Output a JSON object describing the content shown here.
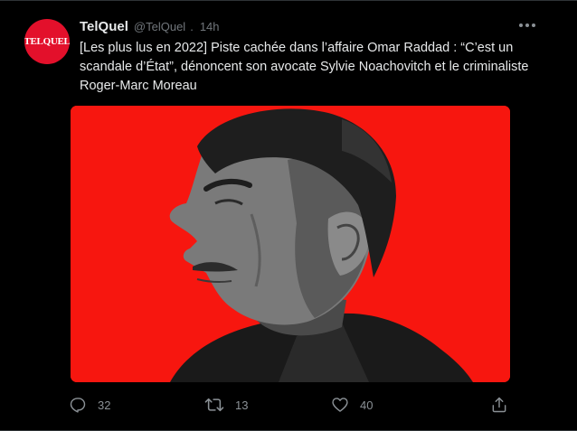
{
  "tweet": {
    "avatar_text": "TELQUEL",
    "display_name": "TelQuel",
    "handle": "@TelQuel",
    "separator": ".",
    "time": "14h",
    "text": "[Les plus lus en 2022] Piste cachée dans l’affaire Omar Raddad : “C’est un scandale d’État”, dénoncent son avocate Sylvie Noachovitch et le criminaliste Roger-Marc Moreau",
    "more_icon": "more-horizontal-icon"
  },
  "actions": {
    "reply": {
      "icon": "reply-icon",
      "count": "32"
    },
    "retweet": {
      "icon": "retweet-icon",
      "count": "13"
    },
    "like": {
      "icon": "heart-icon",
      "count": "40"
    },
    "share": {
      "icon": "share-icon"
    }
  },
  "colors": {
    "background": "#000000",
    "text": "#e7e9ea",
    "secondary_text": "#71767b",
    "brand_red": "#e3102b",
    "media_red": "#f7160f"
  }
}
